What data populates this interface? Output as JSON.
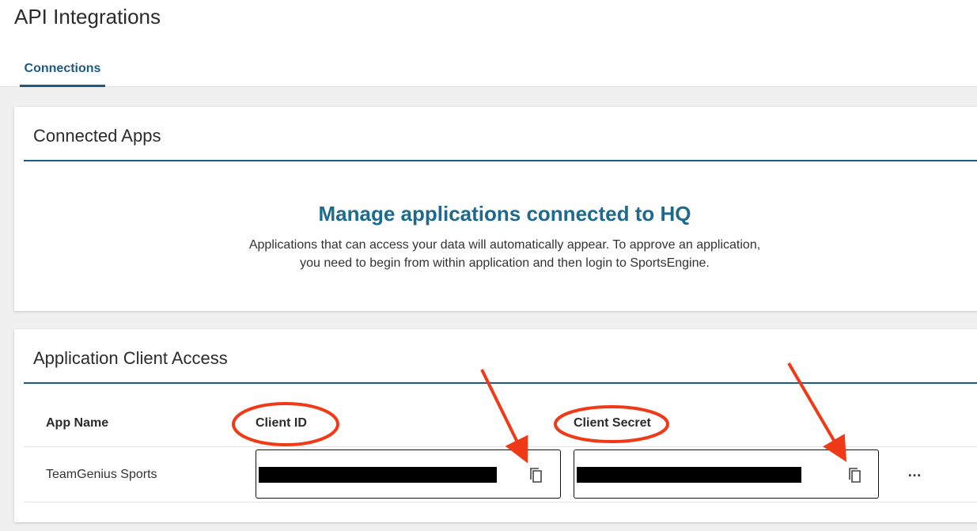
{
  "page": {
    "title": "API Integrations"
  },
  "tabs": [
    {
      "label": "Connections",
      "active": true
    }
  ],
  "connected_apps": {
    "heading": "Connected Apps",
    "hero_title": "Manage applications connected to HQ",
    "hero_text_line1": "Applications that can access your data will automatically appear. To approve an application,",
    "hero_text_line2": "you need to begin from within application and then login to SportsEngine."
  },
  "client_access": {
    "heading": "Application Client Access",
    "columns": {
      "app_name": "App Name",
      "client_id": "Client ID",
      "client_secret": "Client Secret"
    },
    "rows": [
      {
        "app_name": "TeamGenius Sports",
        "client_id": "[redacted]",
        "client_secret": "[redacted]",
        "more": "…"
      }
    ]
  },
  "annotations": {
    "color": "#f03a17",
    "circled": [
      "Client ID",
      "Client Secret"
    ],
    "arrows": [
      "copy-client-id",
      "copy-client-secret"
    ]
  },
  "colors": {
    "accent": "#1d5a86",
    "hero": "#1d6a8e",
    "background": "#f0f0f0"
  }
}
